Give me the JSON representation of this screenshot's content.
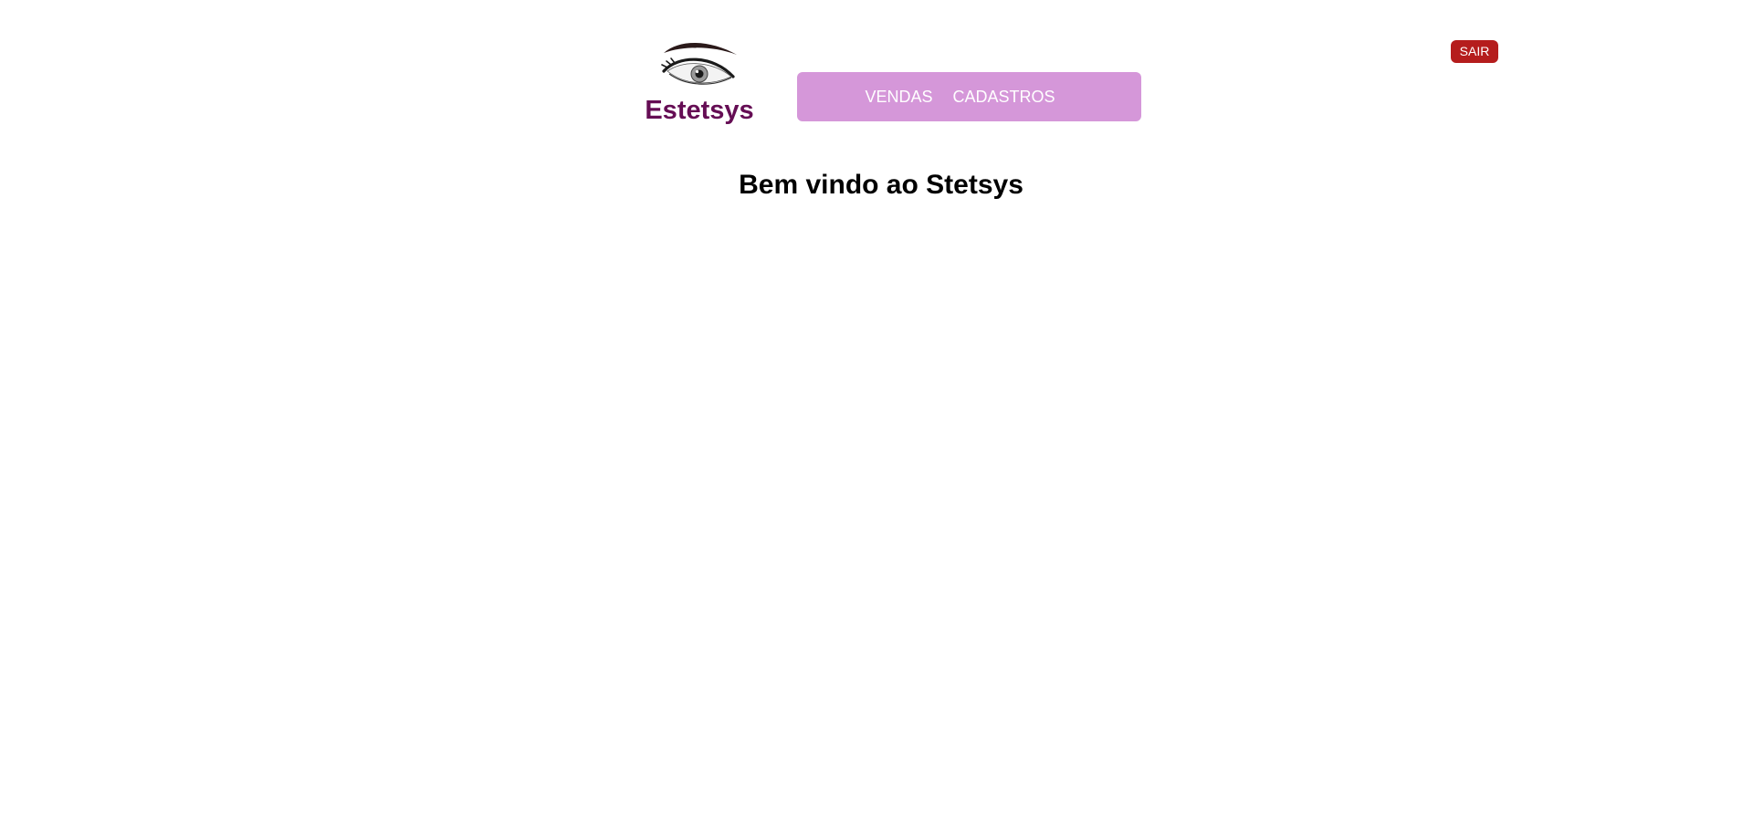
{
  "brand": {
    "name": "Estetsys",
    "logo_icon": "eye-icon",
    "name_color": "#650d54"
  },
  "nav": {
    "background_color": "#d597d9",
    "items": [
      {
        "label": "VENDAS"
      },
      {
        "label": "CADASTROS"
      }
    ]
  },
  "header": {
    "logout_label": "SAIR",
    "logout_color": "#b51d1d"
  },
  "main": {
    "welcome_title": "Bem vindo ao Stetsys"
  }
}
